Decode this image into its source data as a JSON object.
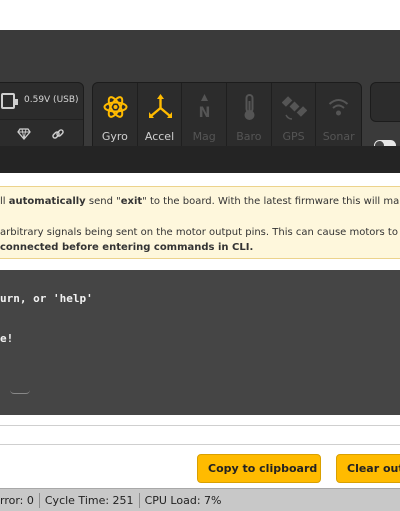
{
  "power": {
    "voltage": "0.59V (USB)"
  },
  "sensors": [
    {
      "label": "Gyro",
      "active": true,
      "icon": "gyro-icon"
    },
    {
      "label": "Accel",
      "active": true,
      "icon": "accel-icon"
    },
    {
      "label": "Mag",
      "active": false,
      "icon": "mag-icon"
    },
    {
      "label": "Baro",
      "active": false,
      "icon": "baro-icon"
    },
    {
      "label": "GPS",
      "active": false,
      "icon": "gps-icon"
    },
    {
      "label": "Sonar",
      "active": false,
      "icon": "sonar-icon"
    }
  ],
  "notice": {
    "l1_pre": "ll ",
    "l1_b1": "automatically",
    "l1_mid": " send \"",
    "l1_b2": "exit",
    "l1_post": "\" to the board. With the latest firmware this will ma",
    "l2": "arbitrary signals being sent on the motor output pins. This can cause motors to",
    "l3": "connected before entering commands in CLI."
  },
  "console": {
    "line1": "urn, or 'help'",
    "line2": "e!"
  },
  "buttons": {
    "copy": "Copy to clipboard",
    "clear": "Clear out"
  },
  "status": {
    "error": "rror: 0",
    "cycle": "Cycle Time: 251",
    "cpu": "CPU Load: 7%"
  },
  "colors": {
    "header": "#3a3a3a",
    "accent": "#ffbb00",
    "sensor_active": "#ffbb00",
    "sensor_inactive": "#555555",
    "notice_bg": "#fef7dc",
    "console_bg": "#454545"
  }
}
